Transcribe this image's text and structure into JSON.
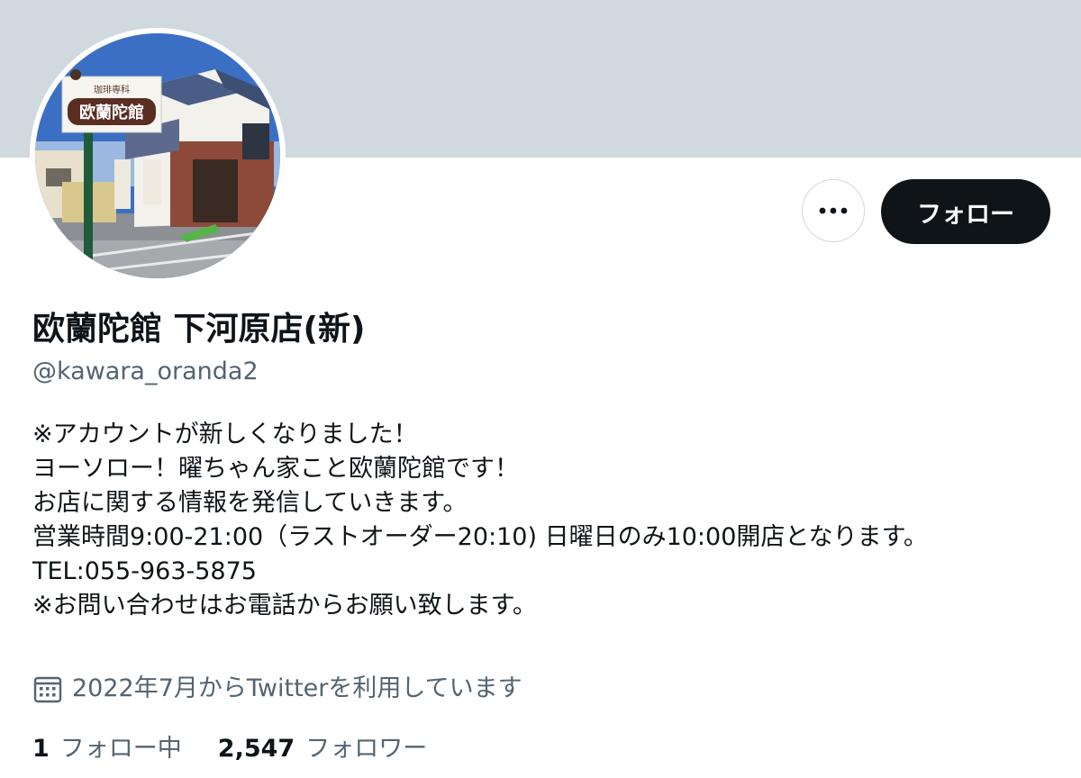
{
  "profile": {
    "display_name": "欧蘭陀館 下河原店(新)",
    "handle": "@kawara_oranda2",
    "bio_lines": [
      "※アカウントが新しくなりました！",
      "ヨーソロー！曜ちゃん家こと欧蘭陀館です！",
      "お店に関する情報を発信していきます。",
      "営業時間9:00-21:00（ラストオーダー20:10) 日曜日のみ10:00開店となります。",
      "TEL:055-963-5875",
      "※お問い合わせはお電話からお願い致します。"
    ],
    "joined": "2022年7月からTwitterを利用しています",
    "avatar_sign": {
      "small": "珈琲専科",
      "large": "欧蘭陀館"
    }
  },
  "actions": {
    "more_icon": "more-horizontal-icon",
    "follow_label": "フォロー"
  },
  "stats": {
    "following_count": "1",
    "following_label": "フォロー中",
    "followers_count": "2,547",
    "followers_label": "フォロワー"
  },
  "colors": {
    "banner": "#cfd9de",
    "text_primary": "#0f1419",
    "text_secondary": "#536471",
    "follow_button": "#0f1419"
  }
}
